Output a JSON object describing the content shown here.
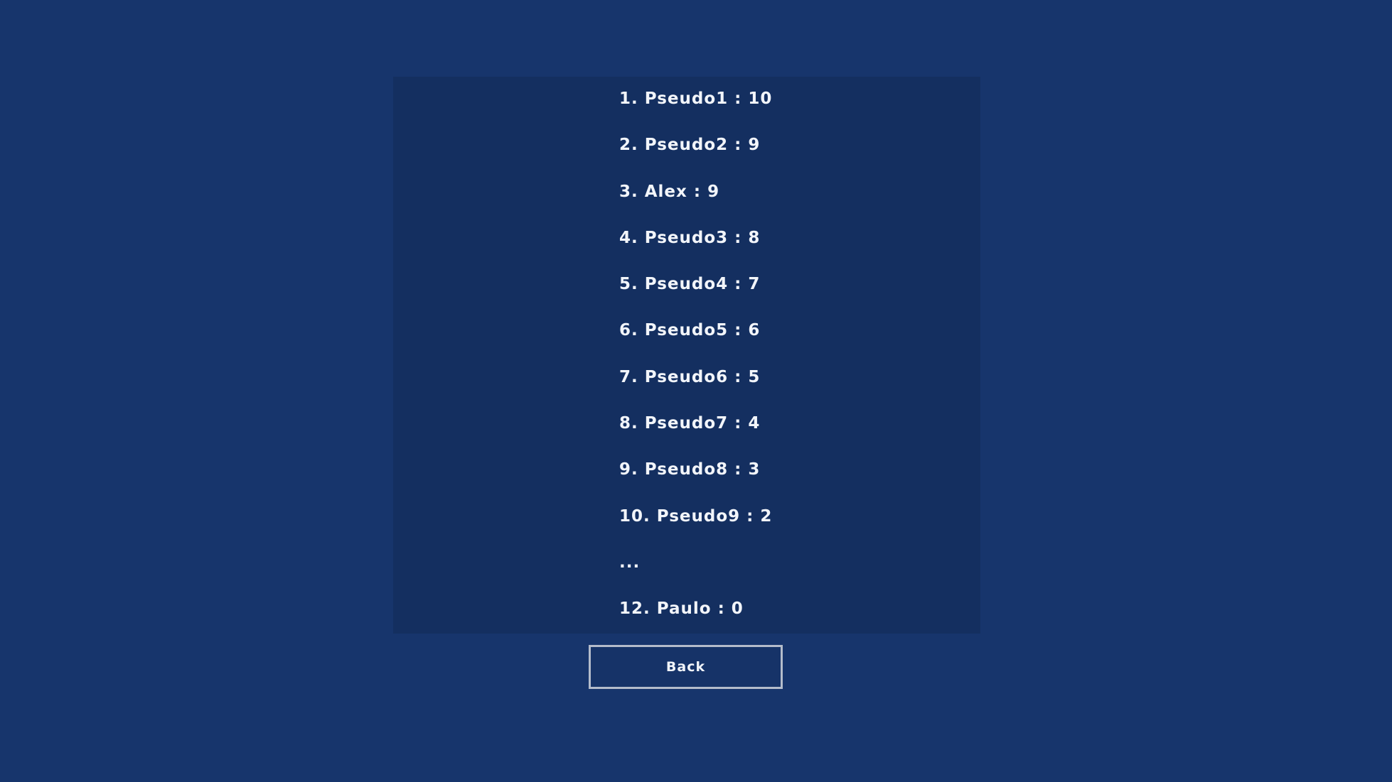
{
  "leaderboard": {
    "entries": [
      "1. Pseudo1 : 10",
      "2. Pseudo2 : 9",
      "3. Alex : 9",
      "4. Pseudo3 : 8",
      "5. Pseudo4 : 7",
      "6. Pseudo5 : 6",
      "7. Pseudo6 : 5",
      "8. Pseudo7 : 4",
      "9. Pseudo8 : 3",
      "10. Pseudo9 : 2",
      "...",
      "12. Paulo : 0"
    ]
  },
  "actions": {
    "back_label": "Back"
  },
  "colors": {
    "background": "#17356c",
    "panel": "#142f60",
    "text": "#f2f5fa",
    "button_border": "#b4bccb"
  }
}
